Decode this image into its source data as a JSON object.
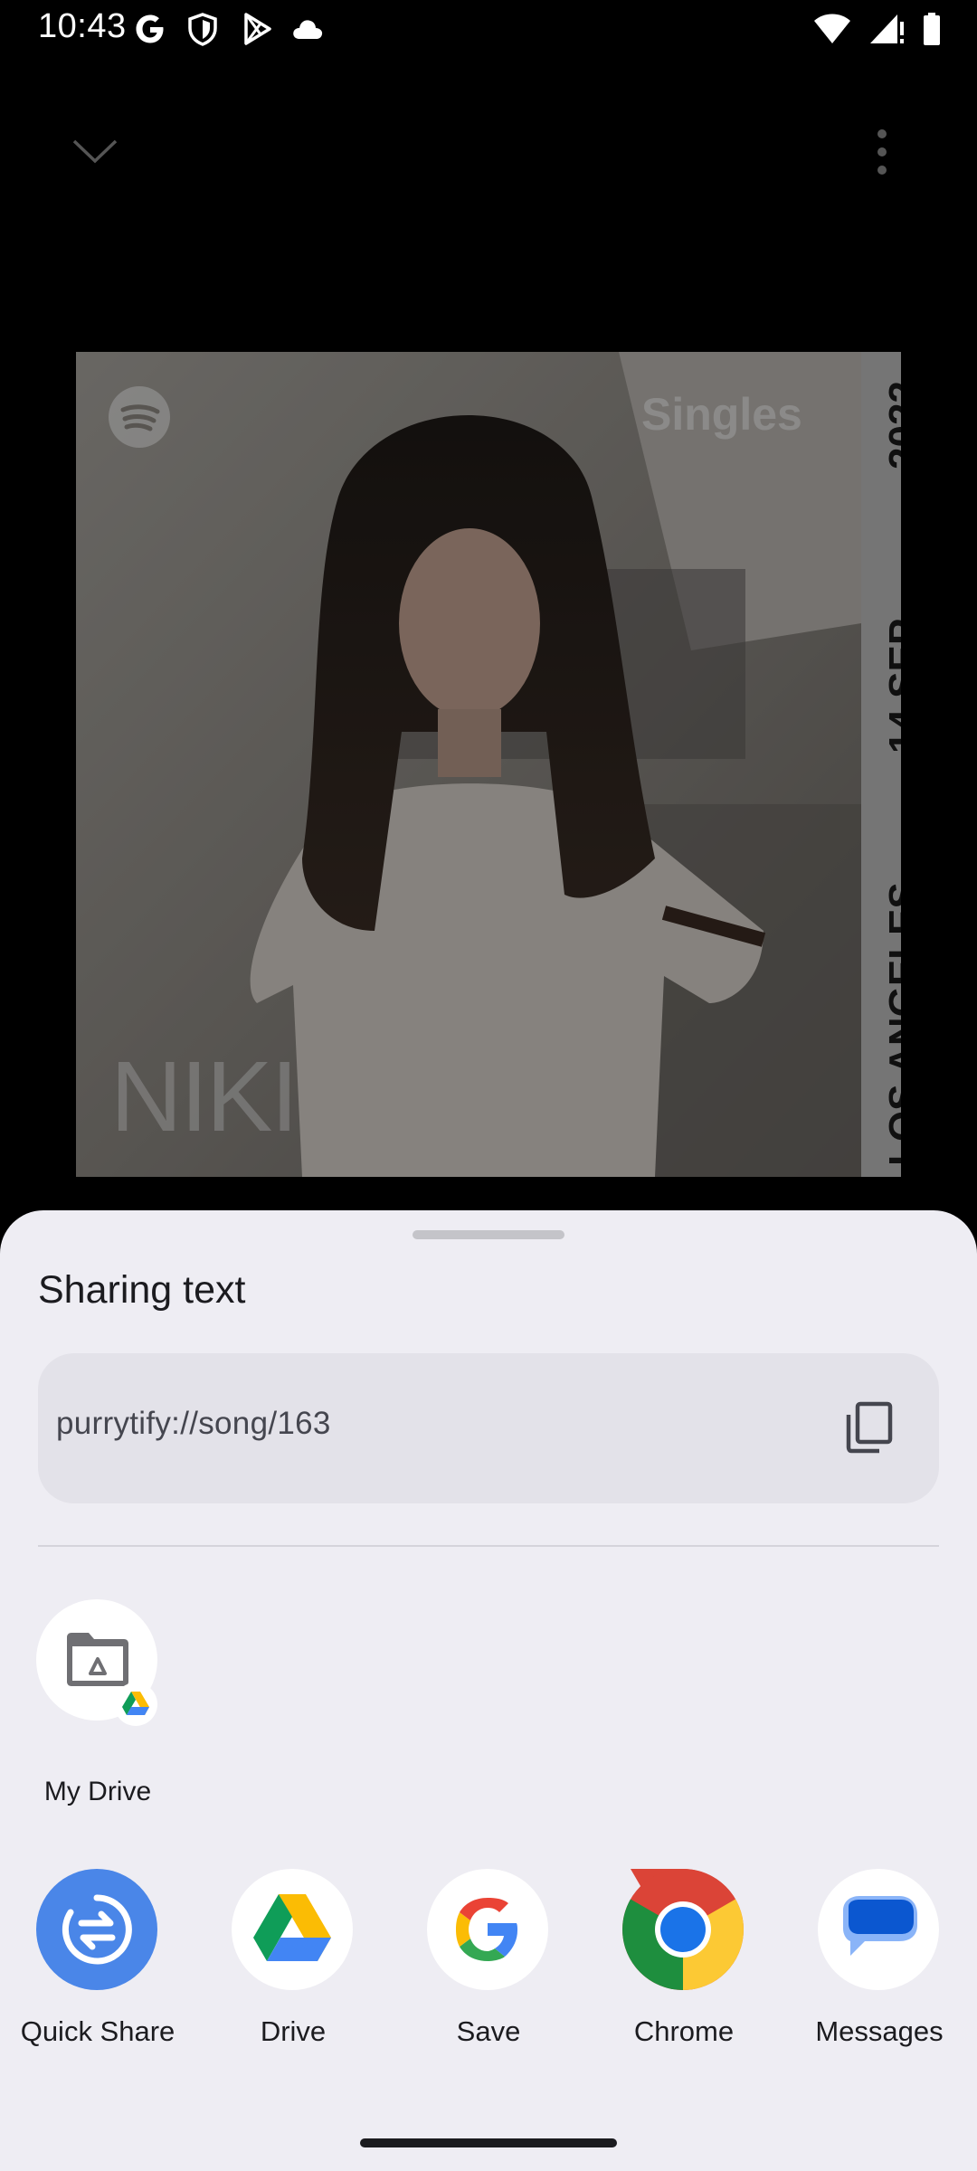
{
  "status_bar": {
    "time": "10:43",
    "left_icons": [
      "google-g-icon",
      "shield-icon",
      "play-store-icon",
      "cloud-icon"
    ],
    "right_icons": [
      "wifi-icon",
      "signal-icon",
      "battery-icon"
    ]
  },
  "player": {
    "collapse_icon": "chevron-down-icon",
    "menu_icon": "more-vert-icon"
  },
  "album_art": {
    "brand": "Singles",
    "artist": "NIKI",
    "strip_year": "2022",
    "strip_date": "14 SEP",
    "strip_city": "LOS ANGELES"
  },
  "share_sheet": {
    "title": "Sharing text",
    "shared_text": "purrytify://song/163",
    "copy_icon": "copy-icon",
    "direct_targets": [
      {
        "label": "My Drive",
        "icon": "folder-drive-icon"
      }
    ],
    "apps": [
      {
        "label": "Quick Share",
        "icon": "quick-share-icon"
      },
      {
        "label": "Drive",
        "icon": "drive-icon"
      },
      {
        "label": "Save",
        "icon": "google-g-icon"
      },
      {
        "label": "Chrome",
        "icon": "chrome-icon"
      },
      {
        "label": "Messages",
        "icon": "messages-icon"
      }
    ]
  },
  "colors": {
    "sheet_background": "#eeedf3",
    "share_box": "#e3e2e9",
    "quick_share_blue": "#4a86e8"
  }
}
